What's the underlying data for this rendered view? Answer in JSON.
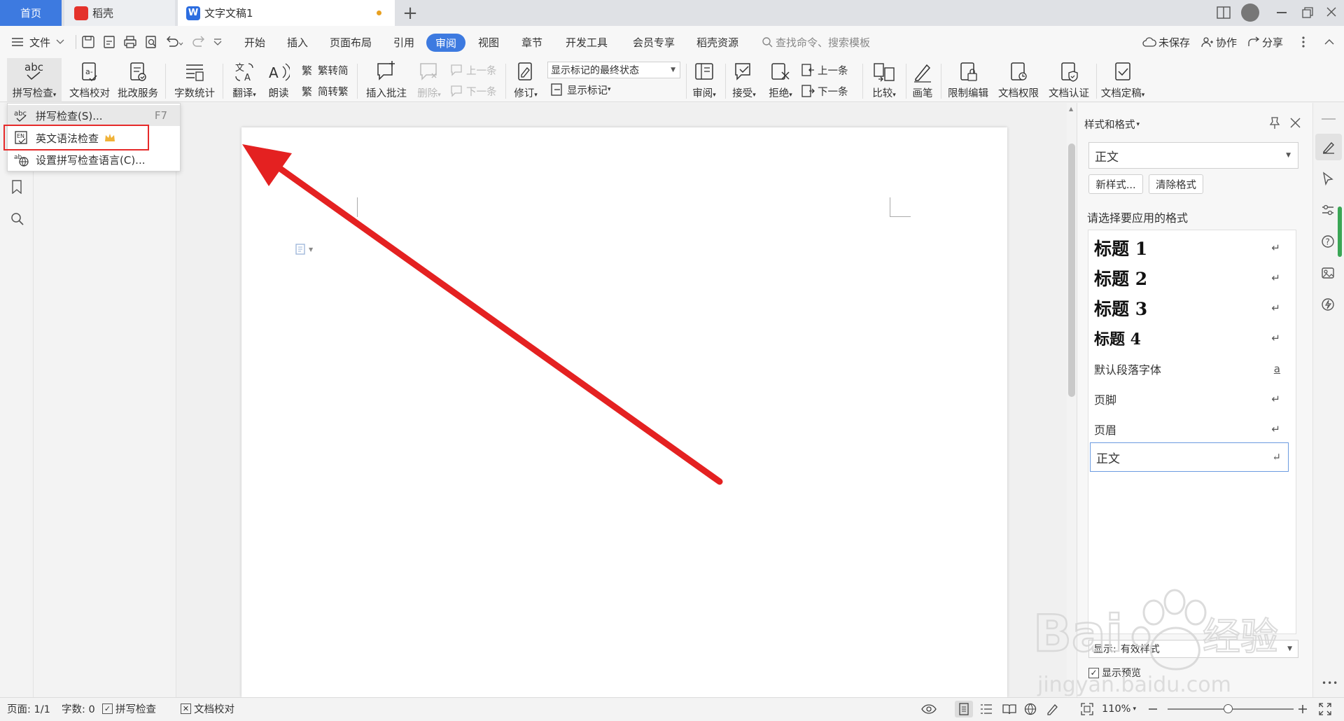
{
  "tabs": {
    "home": "首页",
    "daoke": "稻壳",
    "doc": "文字文稿1",
    "plus": "+"
  },
  "menu": {
    "file": "文件",
    "items": [
      "开始",
      "插入",
      "页面布局",
      "引用",
      "审阅",
      "视图",
      "章节",
      "开发工具",
      "会员专享",
      "稻壳资源"
    ],
    "search_placeholder": "查找命令、搜索模板",
    "unsaved": "未保存",
    "collab": "协作",
    "share": "分享"
  },
  "ribbon": {
    "spell_check": "拼写检查",
    "doc_proof": "文档校对",
    "revise_service": "批改服务",
    "word_count": "字数统计",
    "translate": "翻译",
    "read_aloud": "朗读",
    "trad_to_simp": "繁转简",
    "simp_to_trad": "简转繁",
    "insert_comment": "插入批注",
    "delete": "删除",
    "prev_item": "上一条",
    "next_item": "下一条",
    "track_changes": "修订",
    "markup_select": "显示标记的最终状态",
    "show_markup": "显示标记",
    "review": "审阅",
    "accept": "接受",
    "reject": "拒绝",
    "prev_change": "上一条",
    "next_change": "下一条",
    "compare": "比较",
    "pen": "画笔",
    "restrict_edit": "限制编辑",
    "doc_permission": "文档权限",
    "doc_certify": "文档认证",
    "doc_finalize": "文档定稿"
  },
  "dropdown": {
    "spell_check": "拼写检查(S)...",
    "spell_shortcut": "F7",
    "grammar_check": "英文语法检查",
    "set_language": "设置拼写检查语言(C)..."
  },
  "style_panel": {
    "title": "样式和格式",
    "current_style": "正文",
    "new_style": "新样式...",
    "clear_format": "清除格式",
    "prompt": "请选择要应用的格式",
    "styles": [
      {
        "name": "标题 1",
        "mark": "↵"
      },
      {
        "name": "标题 2",
        "mark": "↵"
      },
      {
        "name": "标题 3",
        "mark": "↵"
      },
      {
        "name": "标题 4",
        "mark": "↵"
      },
      {
        "name": "默认段落字体",
        "mark": "a"
      },
      {
        "name": "页脚",
        "mark": "↵"
      },
      {
        "name": "页眉",
        "mark": "↵"
      },
      {
        "name": "正文",
        "mark": "↵"
      }
    ],
    "show_label": "显示:",
    "show_value": "有效样式",
    "preview_label": "显示预览"
  },
  "status": {
    "page": "页面: 1/1",
    "words": "字数: 0",
    "spell_check": "拼写检查",
    "doc_proof": "文档校对",
    "zoom": "110%"
  },
  "watermark": {
    "brand": "Bai",
    "brand2": "经验",
    "url": "jingyan.baidu.com"
  },
  "colors": {
    "accent": "#3d7ae0",
    "highlight": "#e62a2a",
    "arrow": "#e42121"
  }
}
